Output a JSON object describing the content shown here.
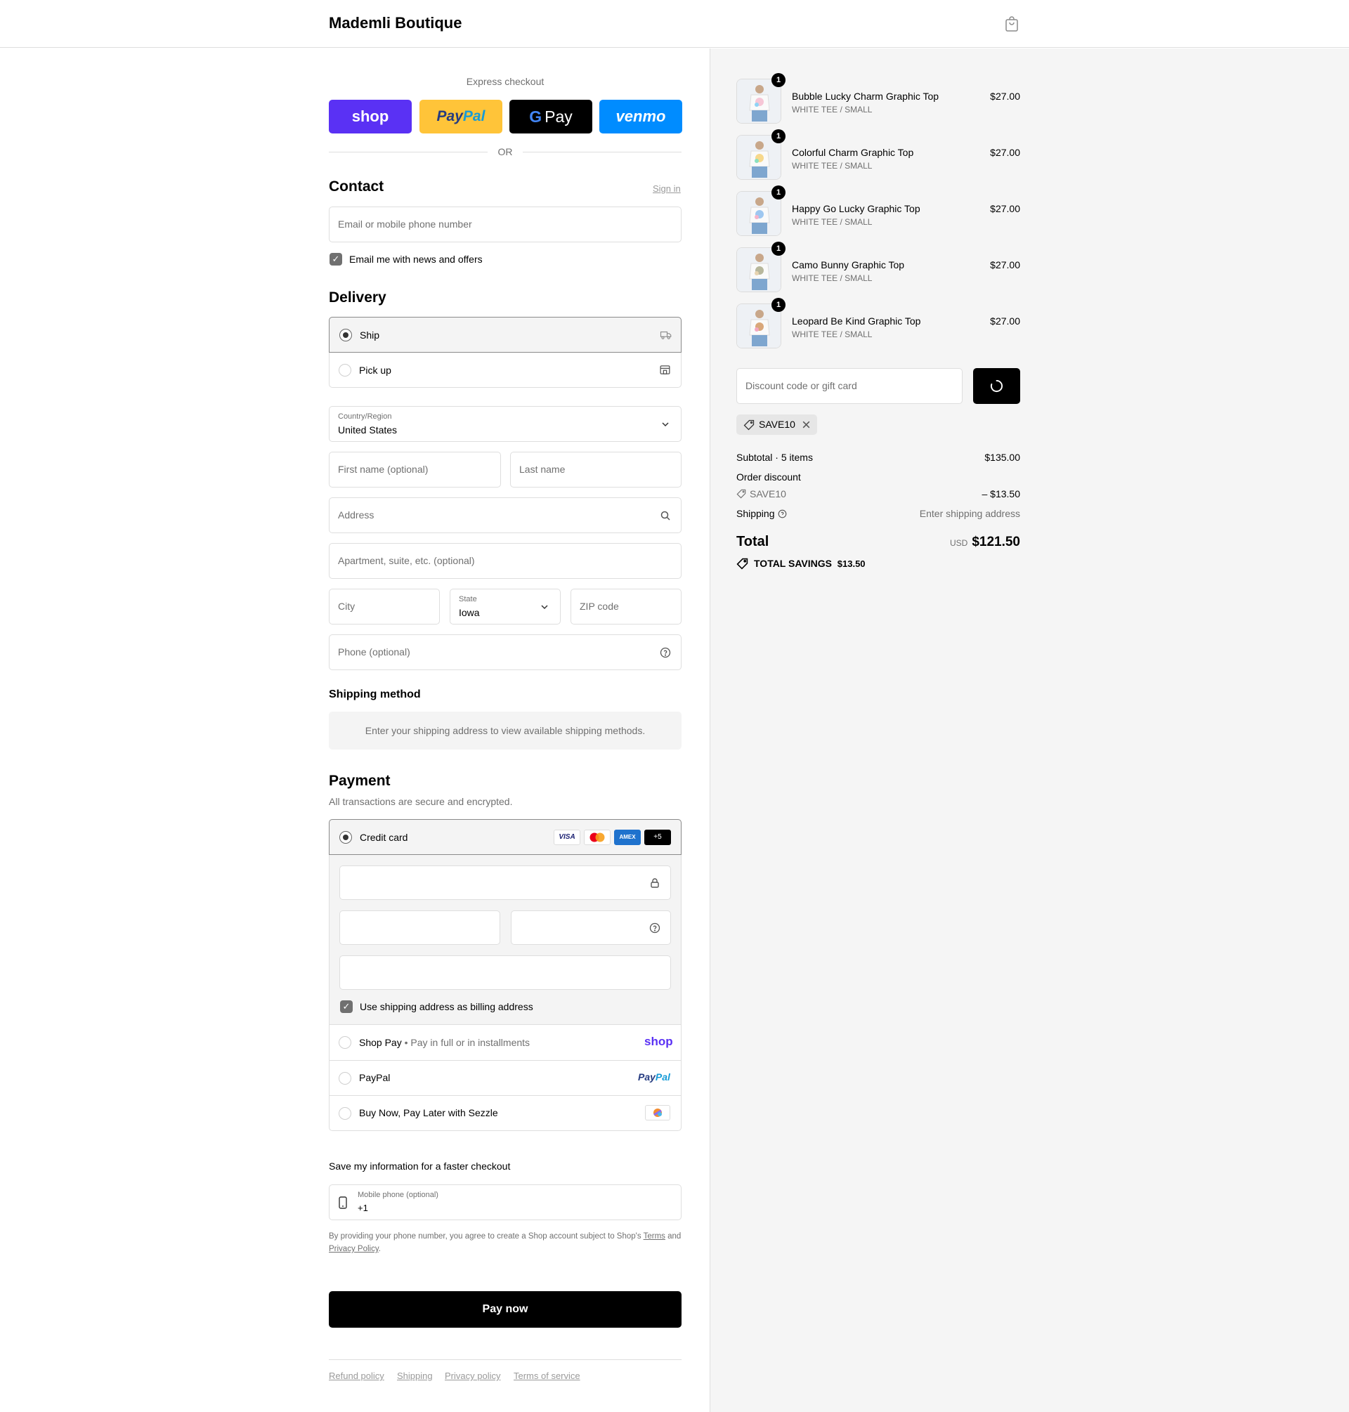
{
  "header": {
    "brand": "Mademli Boutique",
    "cart_icon": "shopping-bag-icon"
  },
  "express": {
    "title": "Express checkout",
    "buttons": [
      {
        "label": "shop",
        "color": "#5a31f4"
      },
      {
        "label": "PayPal",
        "color": "#ffc439"
      },
      {
        "label": "G Pay",
        "color": "#000000"
      },
      {
        "label": "venmo",
        "color": "#008cff"
      }
    ],
    "or": "OR"
  },
  "contact": {
    "title": "Contact",
    "sign_in": "Sign in",
    "email_placeholder": "Email or mobile phone number",
    "news_label": "Email me with news and offers",
    "news_checked": true
  },
  "delivery": {
    "title": "Delivery",
    "options": [
      {
        "label": "Ship",
        "selected": true,
        "icon": "truck-icon"
      },
      {
        "label": "Pick up",
        "selected": false,
        "icon": "store-icon"
      }
    ],
    "country_label": "Country/Region",
    "country_value": "United States",
    "first_name_placeholder": "First name (optional)",
    "last_name_placeholder": "Last name",
    "address_placeholder": "Address",
    "apartment_placeholder": "Apartment, suite, etc. (optional)",
    "city_placeholder": "City",
    "state_label": "State",
    "state_value": "Iowa",
    "zip_placeholder": "ZIP code",
    "phone_placeholder": "Phone (optional)"
  },
  "shipping_method": {
    "title": "Shipping method",
    "message": "Enter your shipping address to view available shipping methods."
  },
  "payment": {
    "title": "Payment",
    "subtitle": "All transactions are secure and encrypted.",
    "credit_card_label": "Credit card",
    "card_logos": [
      "VISA",
      "MC",
      "AMEX",
      "+5"
    ],
    "billing_label": "Use shipping address as billing address",
    "billing_checked": true,
    "options": [
      {
        "label": "Shop Pay",
        "sub": "Pay in full or in installments",
        "logo": "shop"
      },
      {
        "label": "PayPal",
        "sub": "",
        "logo": "PayPal"
      },
      {
        "label": "Buy Now, Pay Later with Sezzle",
        "sub": "",
        "logo": "sezzle-icon"
      }
    ]
  },
  "save_info": {
    "title": "Save my information for a faster checkout",
    "mobile_label": "Mobile phone (optional)",
    "mobile_value": "+1",
    "disclaimer_pre": "By providing your phone number, you agree to create a Shop account subject to Shop's",
    "terms": "Terms",
    "and": "and",
    "privacy": "Privacy Policy",
    "period": "."
  },
  "pay_now": "Pay now",
  "footer_links": [
    "Refund policy",
    "Shipping",
    "Privacy policy",
    "Terms of service"
  ],
  "cart": {
    "items": [
      {
        "name": "Bubble Lucky Charm Graphic Top",
        "variant": "WHITE TEE / SMALL",
        "price": "$27.00",
        "qty": "1"
      },
      {
        "name": "Colorful Charm Graphic Top",
        "variant": "WHITE TEE / SMALL",
        "price": "$27.00",
        "qty": "1"
      },
      {
        "name": "Happy Go Lucky Graphic Top",
        "variant": "WHITE TEE / SMALL",
        "price": "$27.00",
        "qty": "1"
      },
      {
        "name": "Camo Bunny Graphic Top",
        "variant": "WHITE TEE / SMALL",
        "price": "$27.00",
        "qty": "1"
      },
      {
        "name": "Leopard Be Kind Graphic Top",
        "variant": "WHITE TEE / SMALL",
        "price": "$27.00",
        "qty": "1"
      }
    ],
    "discount_placeholder": "Discount code or gift card",
    "applied_code": "SAVE10",
    "subtotal_label": "Subtotal · 5 items",
    "subtotal_value": "$135.00",
    "order_discount_label": "Order discount",
    "discount_code": "SAVE10",
    "discount_value": "– $13.50",
    "shipping_label": "Shipping",
    "shipping_value": "Enter shipping address",
    "total_label": "Total",
    "currency": "USD",
    "total_value": "$121.50",
    "savings_label": "TOTAL SAVINGS",
    "savings_value": "$13.50"
  }
}
